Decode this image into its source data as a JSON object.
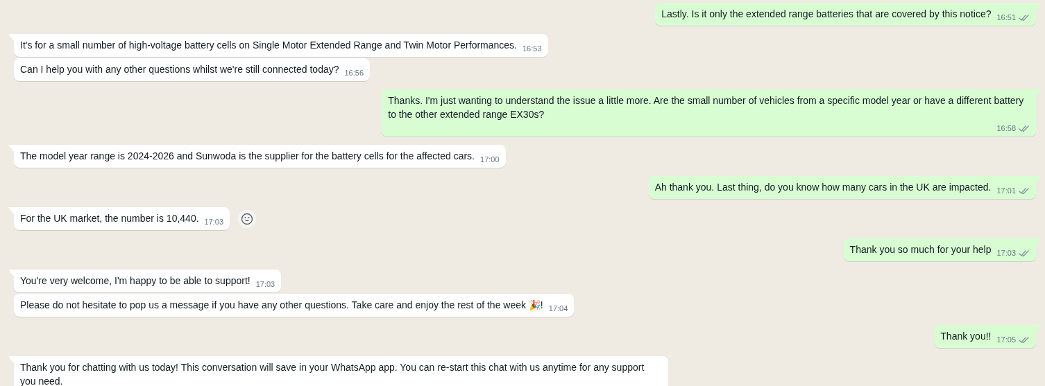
{
  "messages": [
    {
      "outgoing": true,
      "tail": true,
      "text": "Lastly. Is it only the extended range batteries that are covered by this notice?",
      "time": "16:51",
      "read": false
    },
    {
      "outgoing": false,
      "tail": true,
      "text": "It's for a small number of high-voltage battery cells on Single Motor Extended Range and Twin Motor Performances.",
      "time": "16:53"
    },
    {
      "outgoing": false,
      "tail": false,
      "text": "Can I help you with any other questions whilst we're still connected today?",
      "time": "16:56"
    },
    {
      "outgoing": true,
      "tail": true,
      "text": "Thanks. I'm just wanting to understand the issue a little more. Are the small number of vehicles from a specific model year or have a different battery to the other extended range EX30s?",
      "time": "16:58",
      "read": false
    },
    {
      "outgoing": false,
      "tail": true,
      "text": "The model year range is 2024-2026 and Sunwoda is the supplier for the battery cells for the affected cars.",
      "time": "17:00"
    },
    {
      "outgoing": true,
      "tail": true,
      "text": "Ah thank you. Last thing, do you know how many cars in the UK are impacted.",
      "time": "17:01",
      "read": false
    },
    {
      "outgoing": false,
      "tail": true,
      "text": "For the UK market, the number is 10,440.",
      "time": "17:03",
      "react_button": true
    },
    {
      "outgoing": true,
      "tail": true,
      "text": "Thank you so much for your help",
      "time": "17:03",
      "read": false
    },
    {
      "outgoing": false,
      "tail": true,
      "text": "You're very welcome, I'm happy to be able to support!",
      "time": "17:03"
    },
    {
      "outgoing": false,
      "tail": false,
      "text": "Please do not hesitate to pop us a message if you have any other questions. Take care and enjoy the rest of the week 🎉!",
      "time": "17:04"
    },
    {
      "outgoing": true,
      "tail": true,
      "text": "Thank you!!",
      "time": "17:05",
      "read": false
    },
    {
      "outgoing": false,
      "tail": true,
      "text": "Thank you for chatting with us today! This conversation will save in your WhatsApp app. You can re-start this chat with us anytime for any support you need."
    }
  ]
}
